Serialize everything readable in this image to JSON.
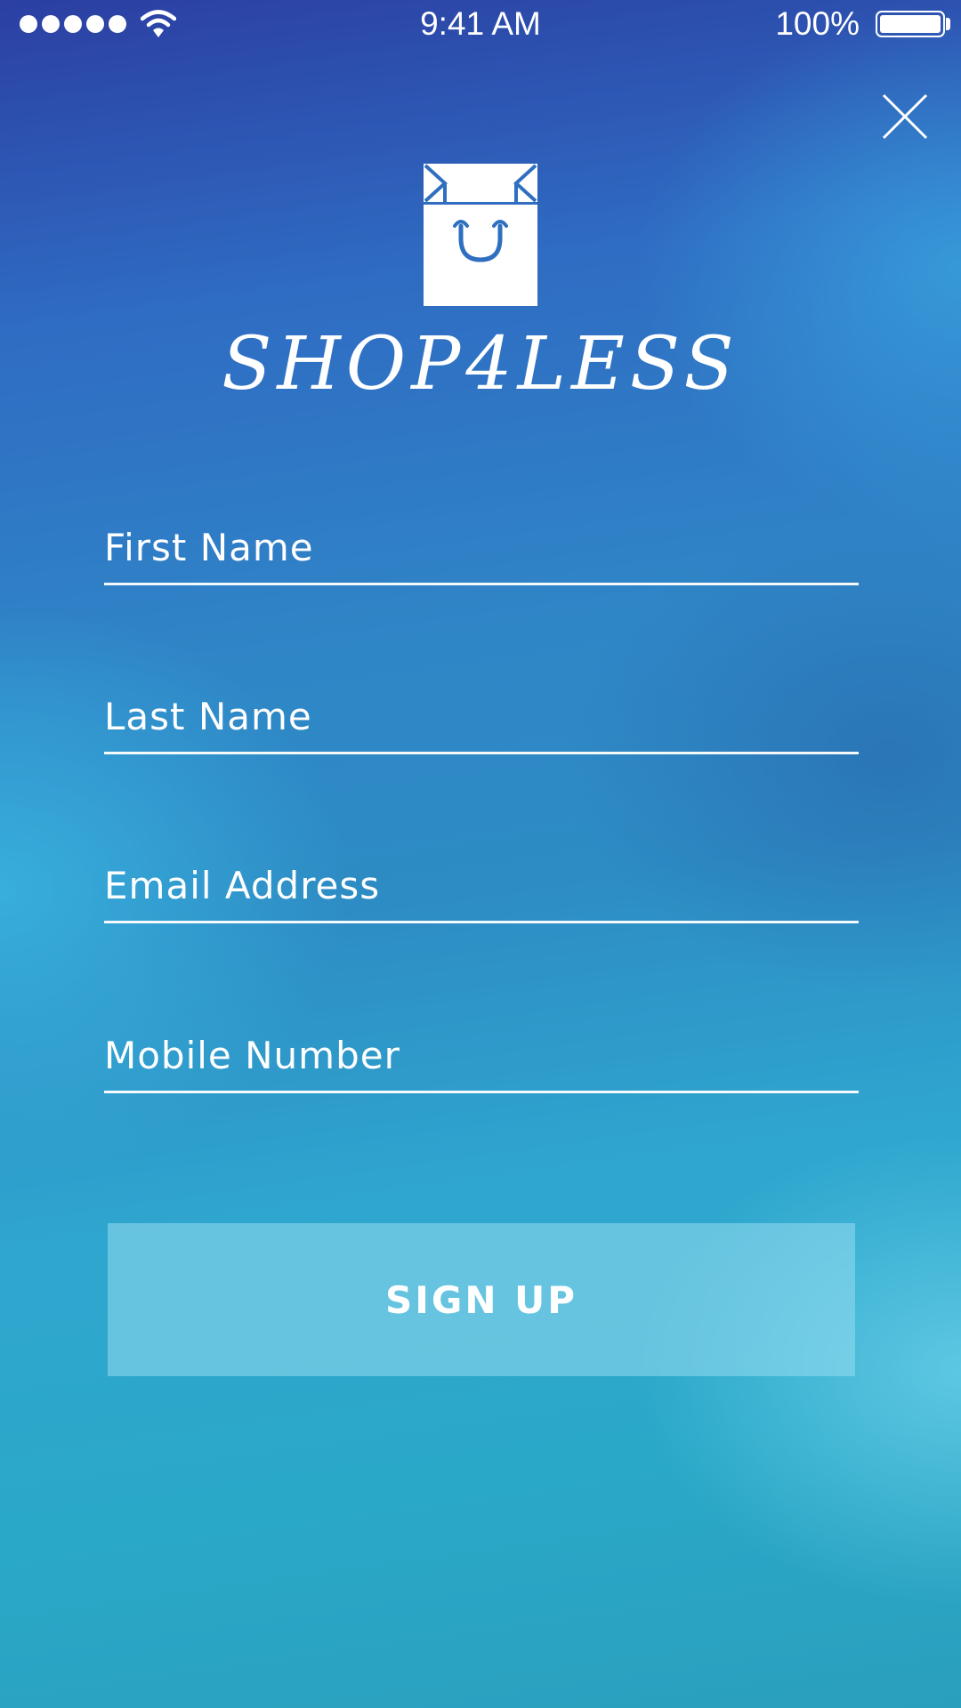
{
  "status_bar": {
    "time": "9:41 AM",
    "battery_percent": "100%",
    "signal_bars": 5,
    "battery_level": 1.0,
    "icons": [
      "signal-dots-icon",
      "wifi-icon",
      "battery-icon"
    ]
  },
  "header": {
    "close_icon": "close-icon"
  },
  "logo": {
    "icon": "shopping-bag-smile-icon",
    "brand_name": "SHOP4LESS"
  },
  "form": {
    "fields": [
      {
        "placeholder": "First Name",
        "value": ""
      },
      {
        "placeholder": "Last Name",
        "value": ""
      },
      {
        "placeholder": "Email Address",
        "value": ""
      },
      {
        "placeholder": "Mobile Number",
        "value": ""
      }
    ],
    "submit_label": "SIGN UP"
  },
  "colors": {
    "bg_top": "#2b3fa2",
    "bg_mid": "#2f86c7",
    "bg_bottom": "#2aa8c8",
    "text": "#ffffff",
    "logo_bag_stroke": "#2f6fc0",
    "button_fill": "#7fcfe8"
  }
}
